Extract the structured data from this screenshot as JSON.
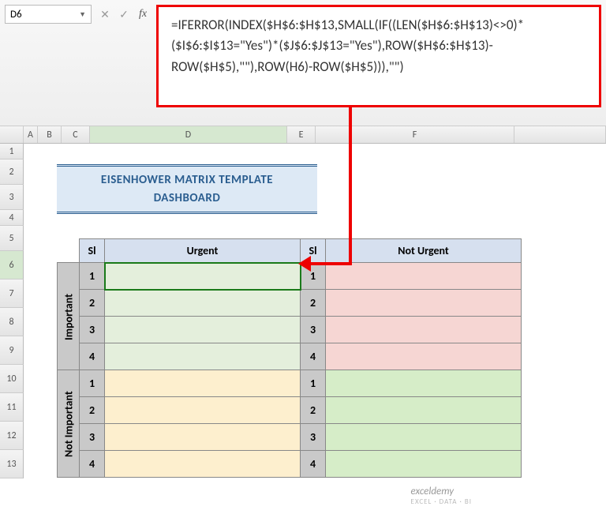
{
  "nameBox": {
    "value": "D6"
  },
  "formulaBar": {
    "text": "=IFERROR(INDEX($H$6:$H$13,SMALL(IF((LEN($H$6:$H$13)<>0)*($I$6:$I$13=\"Yes\")*($J$6:$J$13=\"Yes\"),ROW($H$6:$H$13)-ROW($H$5),\"\"),ROW(H6)-ROW($H$5))),\"\")"
  },
  "columns": [
    "",
    "A",
    "B",
    "C",
    "D",
    "E",
    "F",
    ""
  ],
  "rows": [
    "1",
    "2",
    "3",
    "4",
    "5",
    "6",
    "7",
    "8",
    "9",
    "10",
    "11",
    "12",
    "13"
  ],
  "title": {
    "line1": "EISENHOWER MATRIX TEMPLATE",
    "line2": "DASHBOARD"
  },
  "headers": {
    "sl": "Sl",
    "urgent": "Urgent",
    "notUrgent": "Not Urgent"
  },
  "vlabels": {
    "important": "Important",
    "notImportant": "Not Important"
  },
  "slNums": [
    "1",
    "2",
    "3",
    "4"
  ],
  "watermark": {
    "main": "exceldemy",
    "sub": "EXCEL · DATA · BI"
  },
  "icons": {
    "cancel": "✕",
    "confirm": "✓",
    "fx": "fx",
    "dd": "▼"
  }
}
